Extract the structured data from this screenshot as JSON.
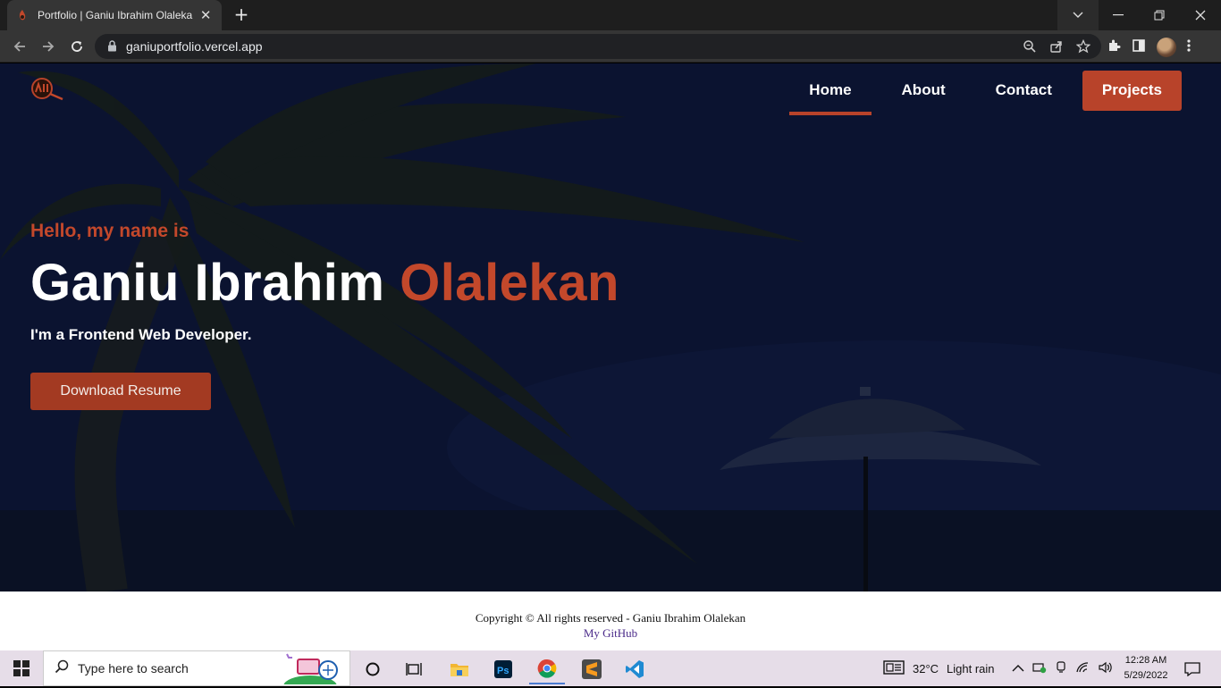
{
  "browser": {
    "tab_title": "Portfolio | Ganiu Ibrahim Olalekan",
    "url": "ganiuportfolio.vercel.app",
    "new_tab_label": "+"
  },
  "nav": {
    "home": "Home",
    "about": "About",
    "contact": "Contact",
    "projects": "Projects",
    "active": "Home"
  },
  "hero": {
    "greeting": "Hello, my name is",
    "name_first": "Ganiu Ibrahim",
    "name_last": "Olalekan",
    "role": "I'm a Frontend Web Developer.",
    "resume_button": "Download Resume"
  },
  "footer": {
    "copyright": "Copyright © All rights reserved - Ganiu Ibrahim Olalekan",
    "github_link": "My GitHub"
  },
  "taskbar": {
    "search_placeholder": "Type here to search",
    "weather_temp": "32°C",
    "weather_desc": "Light rain",
    "time": "12:28 AM",
    "date": "5/29/2022"
  },
  "colors": {
    "accent": "#b8432a",
    "page_bg": "#0b1430",
    "footer_link": "#4b2b8a"
  },
  "icons": [
    "back-icon",
    "forward-icon",
    "reload-icon",
    "lock-icon",
    "zoom-icon",
    "share-icon",
    "star-icon",
    "extensions-icon",
    "sidepanel-icon",
    "windows-start-icon",
    "search-icon",
    "cortana-icon",
    "task-view-icon",
    "file-explorer-icon",
    "photoshop-icon",
    "chrome-icon",
    "sublime-icon",
    "vscode-icon",
    "weather-icon",
    "network-icon",
    "volume-icon",
    "notification-icon"
  ]
}
